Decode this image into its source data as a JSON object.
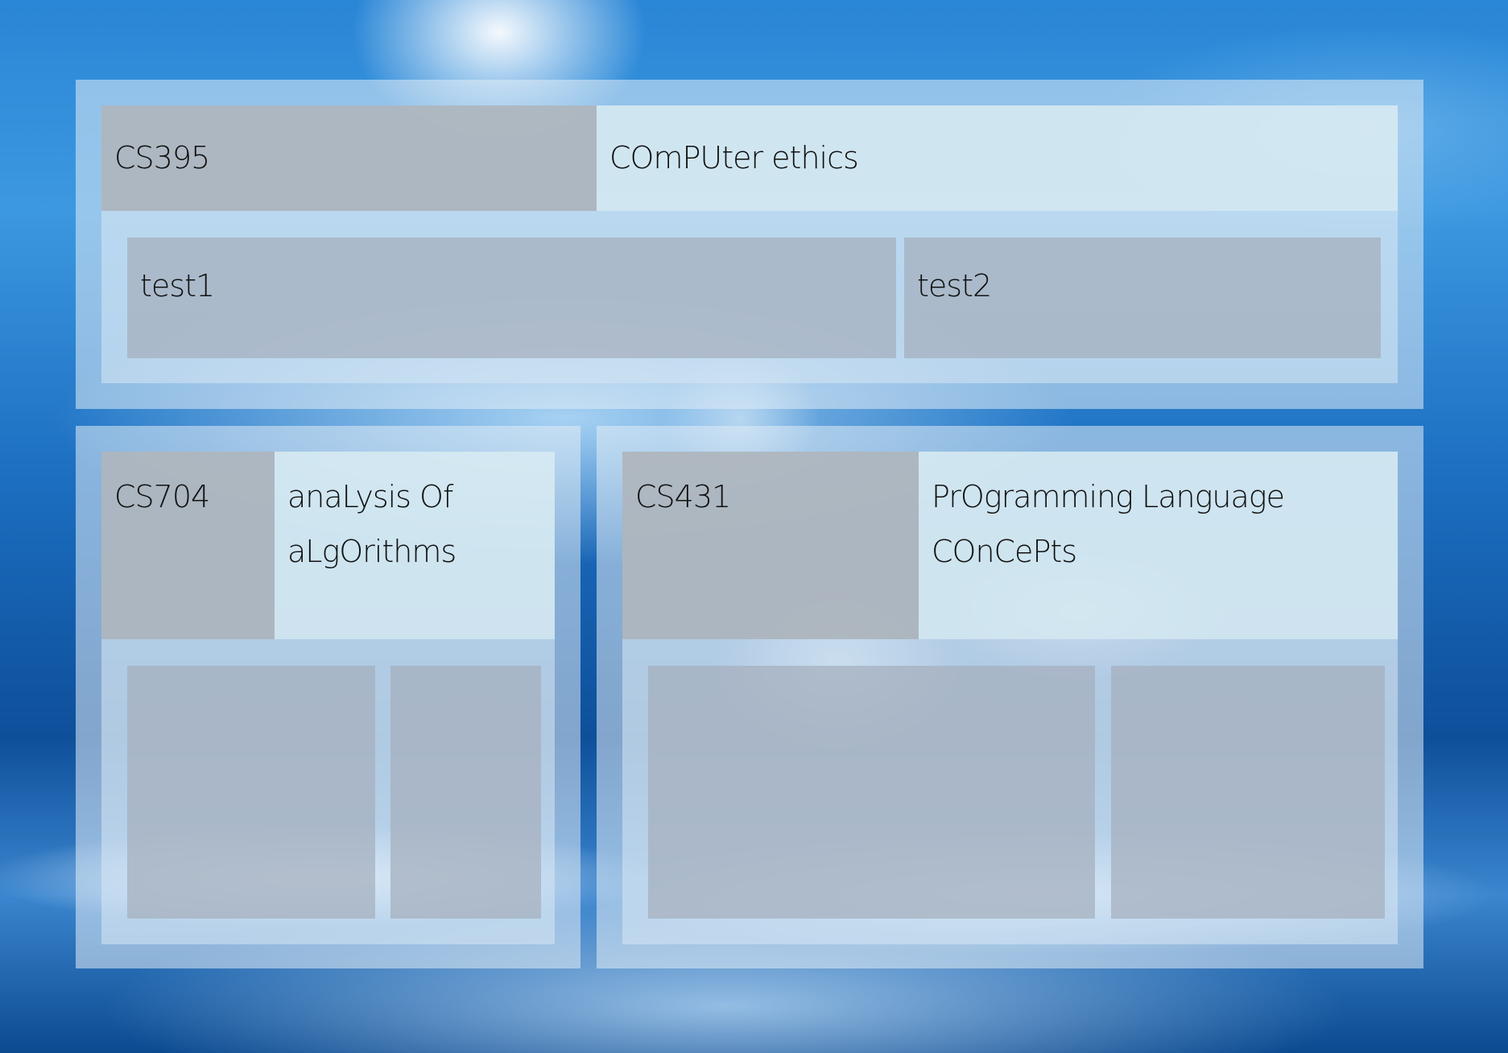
{
  "courses": [
    {
      "code": "CS395",
      "name": "COmPUter ethics",
      "items": [
        "test1",
        "test2"
      ]
    },
    {
      "code": "CS704",
      "name": "anaLysis Of aLgOrithms",
      "items": [
        "",
        ""
      ]
    },
    {
      "code": "CS431",
      "name": "PrOgramming Language COnCePts",
      "items": [
        "",
        ""
      ]
    }
  ]
}
